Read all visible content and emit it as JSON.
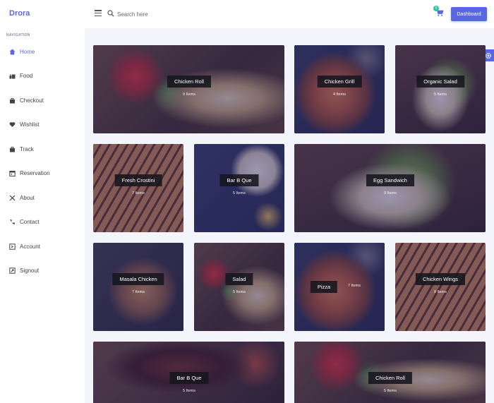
{
  "header": {
    "brand": "Drora",
    "search_placeholder": "Search here",
    "cart_badge": "0",
    "dashboard_label": "Dashboard"
  },
  "sidebar": {
    "heading": "NAVIGATION",
    "items": [
      {
        "label": "Home",
        "icon": "home-icon"
      },
      {
        "label": "Food",
        "icon": "food-icon"
      },
      {
        "label": "Checkout",
        "icon": "bag-icon"
      },
      {
        "label": "Wishlist",
        "icon": "heart-icon"
      },
      {
        "label": "Track",
        "icon": "bag-icon"
      },
      {
        "label": "Reservation",
        "icon": "calendar-icon"
      },
      {
        "label": "About",
        "icon": "utensils-icon"
      },
      {
        "label": "Contact",
        "icon": "phone-icon"
      },
      {
        "label": "Account",
        "icon": "account-icon"
      },
      {
        "label": "Signout",
        "icon": "signout-icon"
      }
    ]
  },
  "categories": [
    {
      "title": "Chicken Roll",
      "count": "9 Items",
      "image": "wrap"
    },
    {
      "title": "Chicken Grill",
      "count": "4 Items",
      "image": "pizza"
    },
    {
      "title": "Organic Salad",
      "count": "5 Items",
      "image": "toast"
    },
    {
      "title": "Fresh Crostini",
      "count": "7 Items",
      "image": "grill"
    },
    {
      "title": "Bar B Que",
      "count": "5 Items",
      "image": "bowl"
    },
    {
      "title": "Egg Sandwich",
      "count": "9 Items",
      "image": "toast"
    },
    {
      "title": "Masala Chicken",
      "count": "7 Items",
      "image": "board"
    },
    {
      "title": "Salad",
      "count": "5 Items",
      "image": "wrap"
    },
    {
      "title": "Pizza",
      "count": "7 Items",
      "image": "pizza"
    },
    {
      "title": "Chicken Wings",
      "count": "8 Items",
      "image": "grill"
    },
    {
      "title": "Bar B Que",
      "count": "5 Items",
      "image": "meat"
    },
    {
      "title": "Chicken Roll",
      "count": "5 Items",
      "image": "wrap"
    }
  ],
  "colors": {
    "accent": "#5a67e4",
    "badge": "#2ec4a1"
  }
}
